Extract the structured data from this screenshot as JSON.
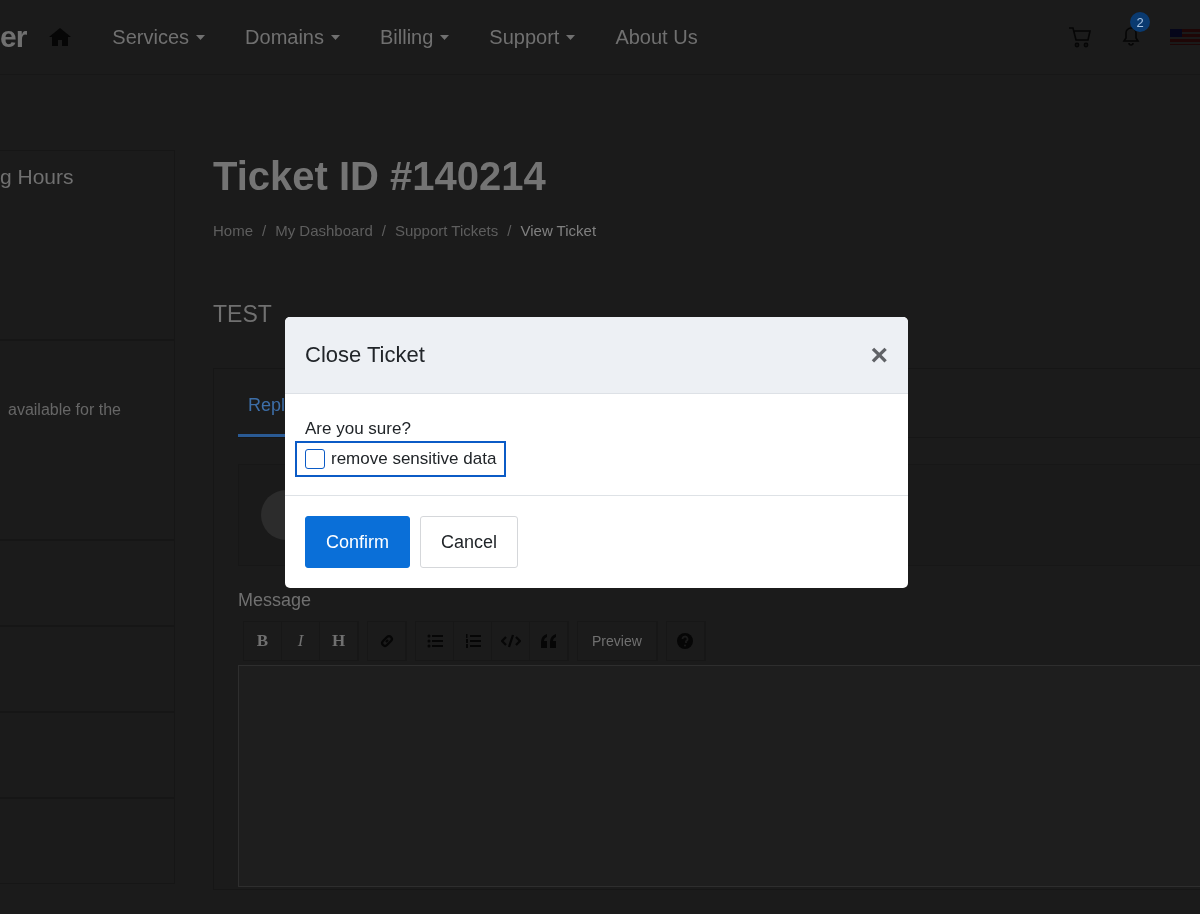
{
  "navbar": {
    "logo_text": "er",
    "menu": [
      {
        "label": "Services",
        "dropdown": true
      },
      {
        "label": "Domains",
        "dropdown": true
      },
      {
        "label": "Billing",
        "dropdown": true
      },
      {
        "label": "Support",
        "dropdown": true
      },
      {
        "label": "About Us",
        "dropdown": false
      }
    ],
    "notification_count": "2"
  },
  "sidebar": {
    "title": "g Hours",
    "text": "available for the"
  },
  "page": {
    "title": "Ticket ID #140214",
    "breadcrumb": [
      {
        "label": "Home",
        "current": false
      },
      {
        "label": "My Dashboard",
        "current": false
      },
      {
        "label": "Support Tickets",
        "current": false
      },
      {
        "label": "View Ticket",
        "current": true
      }
    ],
    "breadcrumb_separator": "/",
    "subject": "TEST",
    "tabs": [
      {
        "label": "Repl",
        "selected": true
      }
    ],
    "message_label": "Message",
    "toolbar": [
      [
        {
          "kind": "bold",
          "label": "B"
        },
        {
          "kind": "italic",
          "label": "I"
        },
        {
          "kind": "heading",
          "label": "H"
        }
      ],
      [
        {
          "kind": "link"
        }
      ],
      [
        {
          "kind": "bullet-list"
        },
        {
          "kind": "numbered-list"
        },
        {
          "kind": "code"
        },
        {
          "kind": "quote"
        }
      ],
      [
        {
          "kind": "preview",
          "label": "Preview"
        }
      ],
      [
        {
          "kind": "help"
        }
      ]
    ]
  },
  "modal": {
    "title": "Close Ticket",
    "close_label": "×",
    "question": "Are you sure?",
    "checkbox": {
      "label": "remove sensitive data",
      "checked": false,
      "focused": true
    },
    "buttons": [
      {
        "label": "Confirm",
        "kind": "primary"
      },
      {
        "label": "Cancel",
        "kind": "secondary"
      }
    ]
  }
}
